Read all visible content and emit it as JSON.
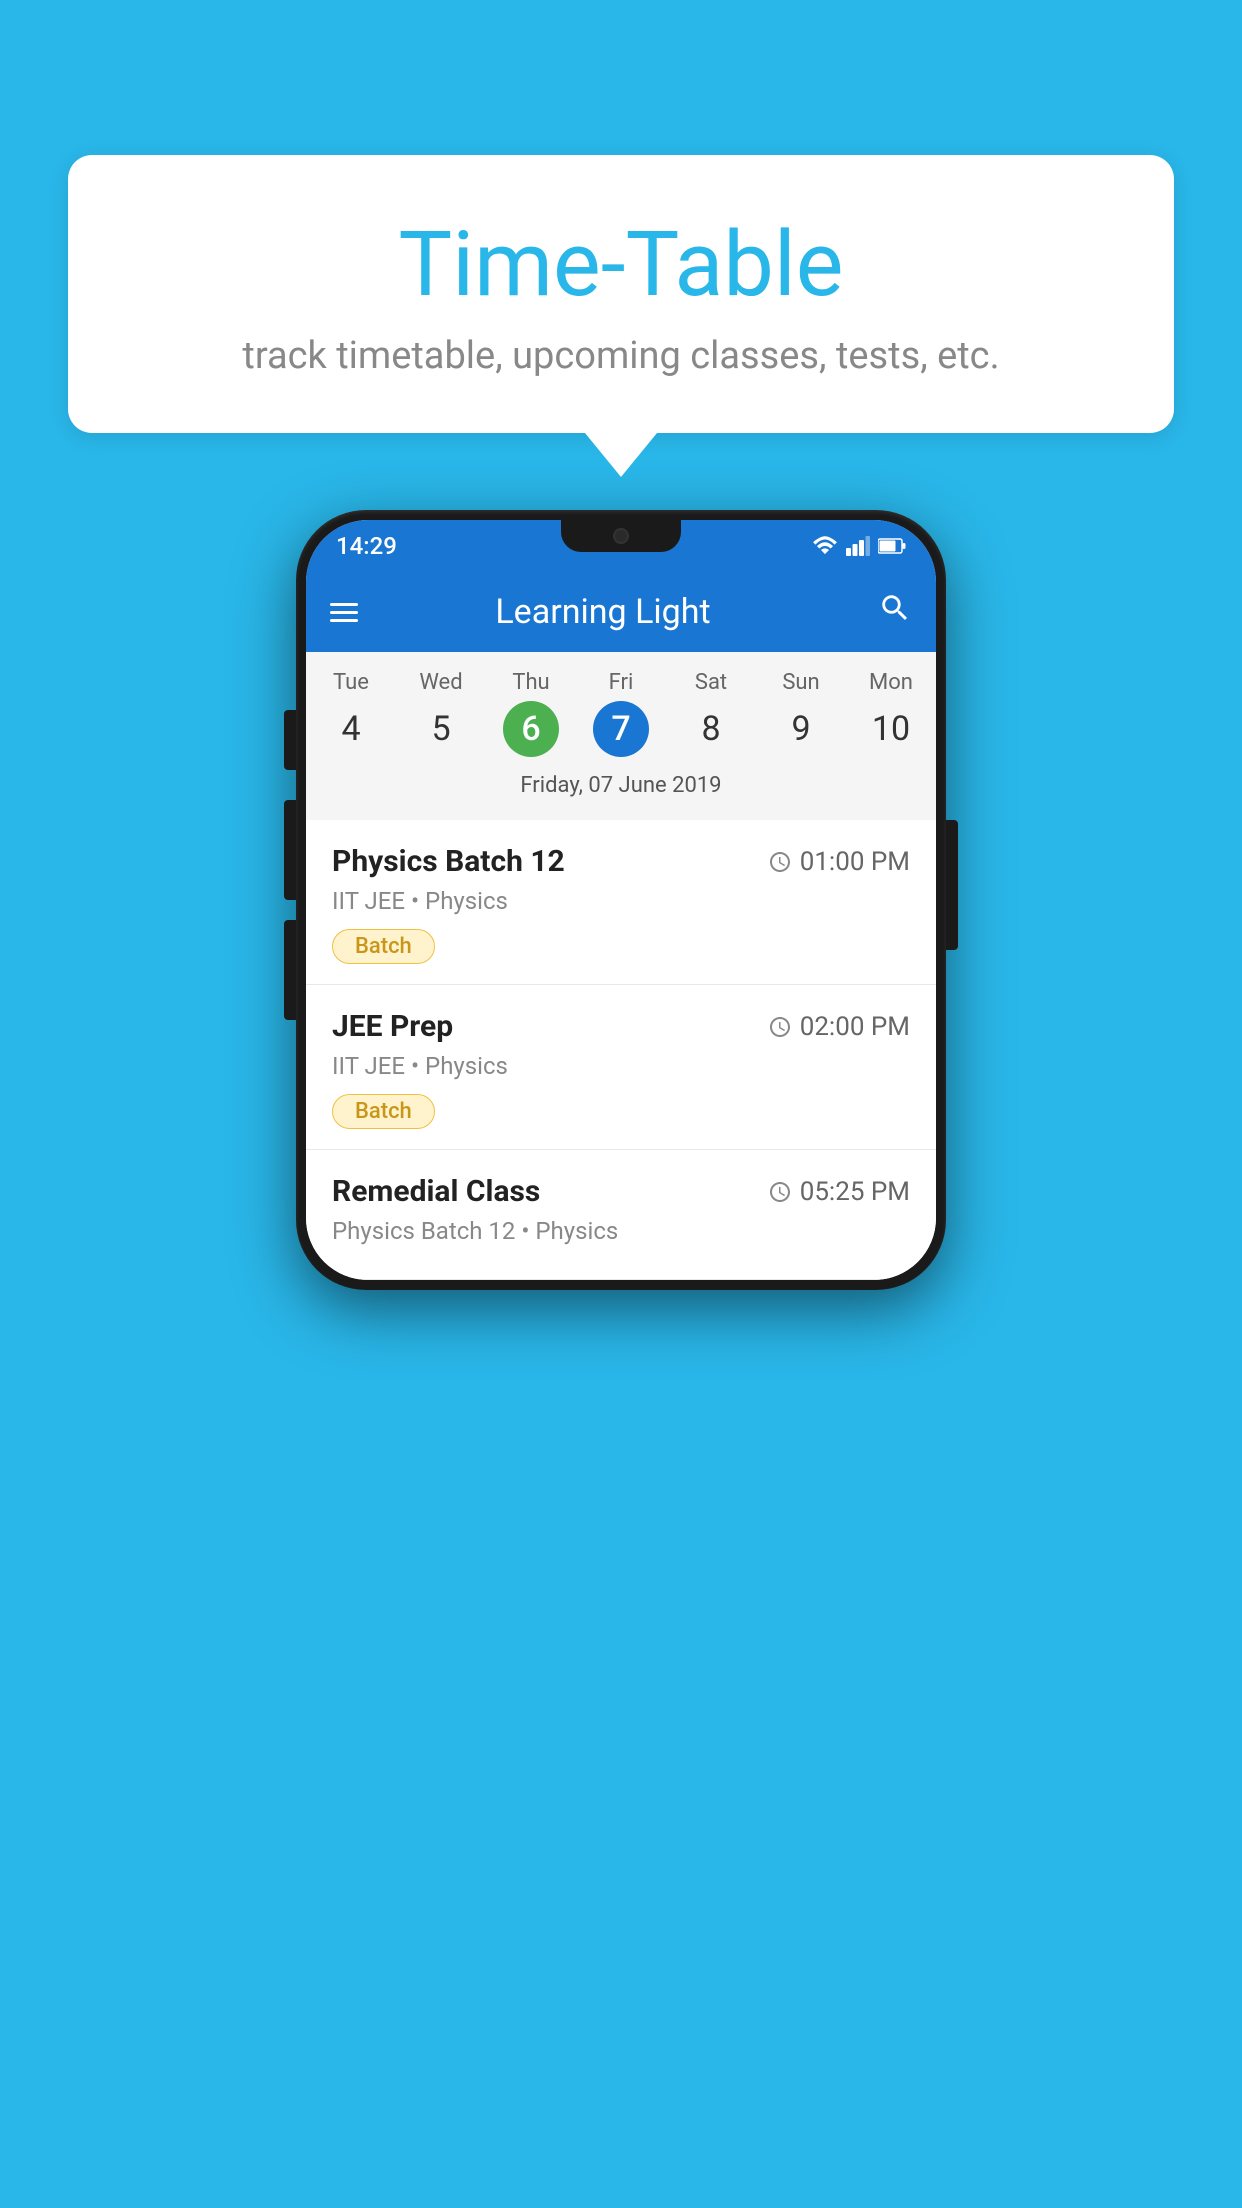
{
  "background_color": "#29B6E8",
  "bubble": {
    "title": "Time-Table",
    "subtitle": "track timetable, upcoming classes, tests, etc."
  },
  "status_bar": {
    "time": "14:29",
    "icons": [
      "wifi",
      "signal",
      "battery"
    ]
  },
  "app_bar": {
    "title": "Learning Light",
    "menu_icon": "hamburger",
    "search_icon": "search"
  },
  "calendar": {
    "days": [
      {
        "name": "Tue",
        "num": "4",
        "state": "normal"
      },
      {
        "name": "Wed",
        "num": "5",
        "state": "normal"
      },
      {
        "name": "Thu",
        "num": "6",
        "state": "today"
      },
      {
        "name": "Fri",
        "num": "7",
        "state": "selected"
      },
      {
        "name": "Sat",
        "num": "8",
        "state": "normal"
      },
      {
        "name": "Sun",
        "num": "9",
        "state": "normal"
      },
      {
        "name": "Mon",
        "num": "10",
        "state": "normal"
      }
    ],
    "selected_date_label": "Friday, 07 June 2019"
  },
  "schedule": [
    {
      "name": "Physics Batch 12",
      "time": "01:00 PM",
      "meta": "IIT JEE • Physics",
      "badge": "Batch"
    },
    {
      "name": "JEE Prep",
      "time": "02:00 PM",
      "meta": "IIT JEE • Physics",
      "badge": "Batch"
    },
    {
      "name": "Remedial Class",
      "time": "05:25 PM",
      "meta": "Physics Batch 12 • Physics",
      "badge": null
    }
  ]
}
